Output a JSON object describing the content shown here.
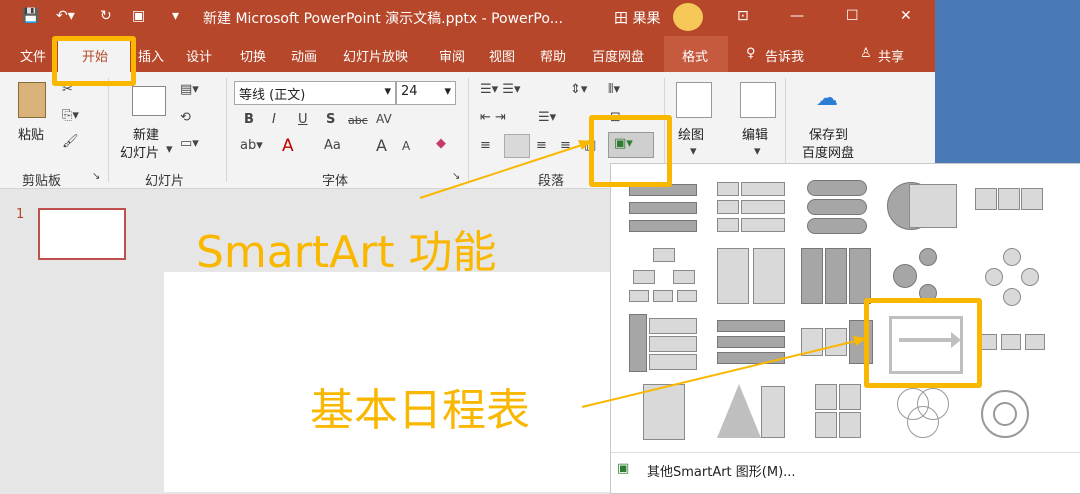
{
  "titlebar": {
    "save_icon": "save-icon",
    "undo_icon": "undo-icon",
    "redo_icon": "redo-icon",
    "present_icon": "present-icon",
    "title": "新建 Microsoft PowerPoint 演示文稿.pptx - PowerPo...",
    "user": "田 果果",
    "minimize": "—",
    "maximize": "☐",
    "close": "✕"
  },
  "tabs": {
    "file": "文件",
    "home": "开始",
    "insert": "插入",
    "design": "设计",
    "transitions": "切换",
    "animations": "动画",
    "slideshow": "幻灯片放映",
    "review": "审阅",
    "view": "视图",
    "help": "帮助",
    "baidu": "百度网盘",
    "format": "格式",
    "tellme": "告诉我",
    "share": "共享"
  },
  "ribbon": {
    "paste": "粘贴",
    "clipboard_group": "剪贴板",
    "new_slide_line1": "新建",
    "new_slide_line2": "幻灯片",
    "slides_group": "幻灯片",
    "font_name": "等线 (正文)",
    "font_size": "24",
    "font_group": "字体",
    "paragraph_group": "段落",
    "drawing": "绘图",
    "editing": "编辑",
    "save_baidu_line1": "保存到",
    "save_baidu_line2": "百度网盘",
    "bold": "B",
    "italic": "I",
    "underline": "U",
    "shadow": "S",
    "strike": "abc",
    "spacing": "AV",
    "case": "Aa",
    "grow": "A",
    "shrink": "A"
  },
  "slides": {
    "number": "1"
  },
  "annotations": {
    "smartart": "SmartArt 功能",
    "timeline": "基本日程表"
  },
  "gallery": {
    "more": "其他SmartArt 图形(M)..."
  },
  "colors": {
    "accent": "#b7472a",
    "highlight": "#f9b700"
  }
}
